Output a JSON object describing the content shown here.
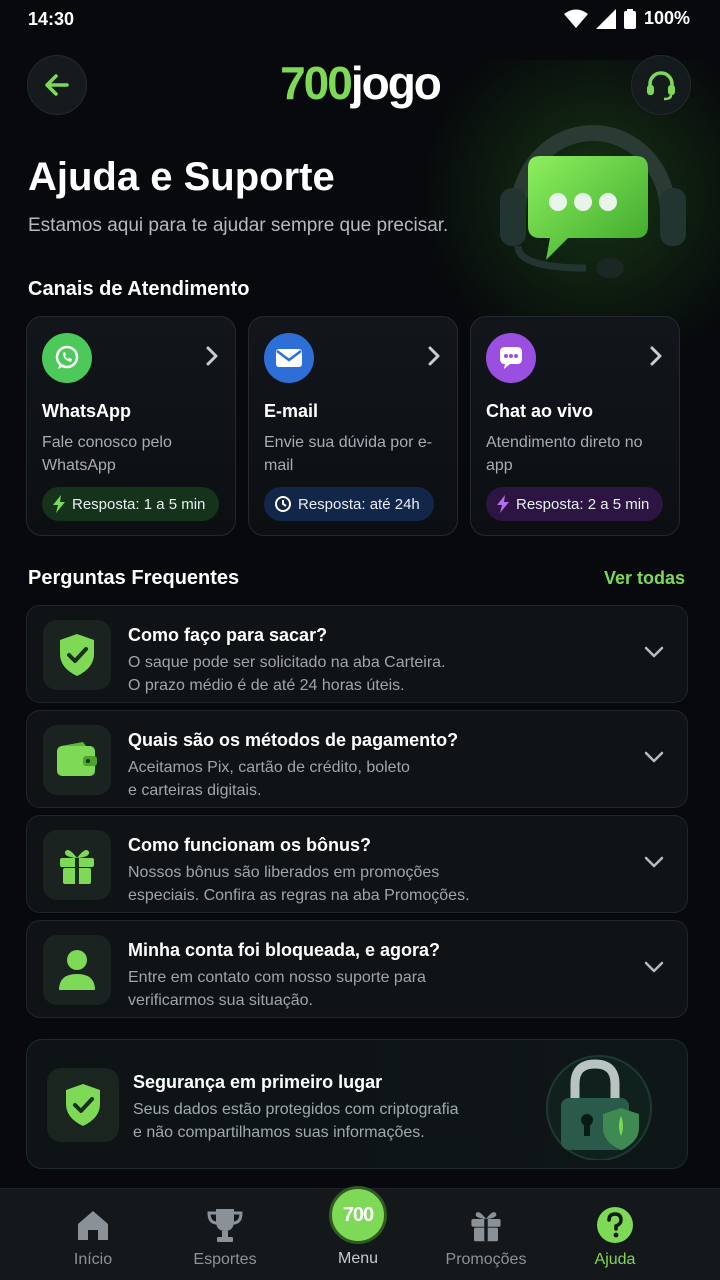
{
  "status": {
    "time": "14:30",
    "battery": "100%"
  },
  "header": {
    "logo_number": "700",
    "logo_word": "jogo"
  },
  "hero": {
    "title": "Ajuda e Suporte",
    "subtitle": "Estamos aqui para te ajudar sempre que precisar."
  },
  "channels": {
    "title": "Canais de Atendimento",
    "items": [
      {
        "name": "WhatsApp",
        "desc": "Fale conosco pelo WhatsApp",
        "badge": "Resposta: 1 a 5 min",
        "icon": "whatsapp-icon",
        "color": "#4cc95a"
      },
      {
        "name": "E-mail",
        "desc": "Envie sua dúvida por e-mail",
        "badge": "Resposta: até 24h",
        "icon": "mail-icon",
        "color": "#2d6fd6"
      },
      {
        "name": "Chat ao vivo",
        "desc": "Atendimento direto no app",
        "badge": "Resposta: 2 a 5 min",
        "icon": "chat-icon",
        "color": "#9b4fe0"
      }
    ]
  },
  "faq": {
    "title": "Perguntas Frequentes",
    "see_all": "Ver todas",
    "items": [
      {
        "q": "Como faço para sacar?",
        "a1": "O saque pode ser solicitado na aba Carteira.",
        "a2": "O prazo médio é de até 24 horas úteis.",
        "icon": "shield-check-icon"
      },
      {
        "q": "Quais são os métodos de pagamento?",
        "a1": "Aceitamos Pix, cartão de crédito, boleto",
        "a2": "e carteiras digitais.",
        "icon": "wallet-icon"
      },
      {
        "q": "Como funcionam os bônus?",
        "a1": "Nossos bônus são liberados em promoções",
        "a2": "especiais. Confira as regras na aba Promoções.",
        "icon": "gift-icon"
      },
      {
        "q": "Minha conta foi bloqueada, e agora?",
        "a1": "Entre em contato com nosso suporte para",
        "a2": "verificarmos sua situação.",
        "icon": "user-icon"
      }
    ]
  },
  "security": {
    "title": "Segurança em primeiro lugar",
    "line1": "Seus dados estão protegidos com criptografia",
    "line2": "e não compartilhamos suas informações."
  },
  "nav": {
    "home": "Início",
    "sports": "Esportes",
    "menu_logo": "700",
    "menu": "Menu",
    "promos": "Promoções",
    "help": "Ajuda"
  },
  "colors": {
    "accent": "#7ed957",
    "background": "#07090c"
  }
}
